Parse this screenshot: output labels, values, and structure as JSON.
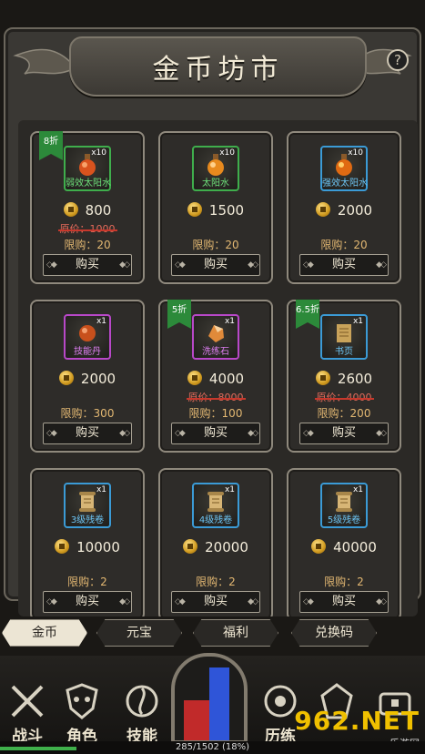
{
  "header": {
    "title": "金币坊市",
    "help_label": "?"
  },
  "items": [
    {
      "name": "弱效太阳水",
      "qty": "x10",
      "price": "800",
      "original": "原价：1000",
      "limit": "限购：20",
      "buy": "购买",
      "discount": "8折",
      "frame_color": "#3fae4c",
      "name_color": "#6de07a",
      "icon": "potion-red-icon"
    },
    {
      "name": "太阳水",
      "qty": "x10",
      "price": "1500",
      "original": "",
      "limit": "限购：20",
      "buy": "购买",
      "discount": "",
      "frame_color": "#3fae4c",
      "name_color": "#6de07a",
      "icon": "potion-orange-icon"
    },
    {
      "name": "强效太阳水",
      "qty": "x10",
      "price": "2000",
      "original": "",
      "limit": "限购：20",
      "buy": "购买",
      "discount": "",
      "frame_color": "#3b9bd6",
      "name_color": "#6cc3f2",
      "icon": "potion-gold-icon"
    },
    {
      "name": "技能丹",
      "qty": "x1",
      "price": "2000",
      "original": "",
      "limit": "限购：300",
      "buy": "购买",
      "discount": "",
      "frame_color": "#b848c8",
      "name_color": "#dc7ef0",
      "icon": "pill-icon"
    },
    {
      "name": "洗练石",
      "qty": "x1",
      "price": "4000",
      "original": "原价：8000",
      "limit": "限购：100",
      "buy": "购买",
      "discount": "5折",
      "frame_color": "#b848c8",
      "name_color": "#dc7ef0",
      "icon": "stone-icon"
    },
    {
      "name": "书页",
      "qty": "x1",
      "price": "2600",
      "original": "原价：4000",
      "limit": "限购：200",
      "buy": "购买",
      "discount": "6.5折",
      "frame_color": "#3b9bd6",
      "name_color": "#6cc3f2",
      "icon": "book-page-icon"
    },
    {
      "name": "3级残卷",
      "qty": "x1",
      "price": "10000",
      "original": "",
      "limit": "限购：2",
      "buy": "购买",
      "discount": "",
      "frame_color": "#3b9bd6",
      "name_color": "#6cc3f2",
      "icon": "scroll-icon"
    },
    {
      "name": "4级残卷",
      "qty": "x1",
      "price": "20000",
      "original": "",
      "limit": "限购：2",
      "buy": "购买",
      "discount": "",
      "frame_color": "#3b9bd6",
      "name_color": "#6cc3f2",
      "icon": "scroll-icon"
    },
    {
      "name": "5级残卷",
      "qty": "x1",
      "price": "40000",
      "original": "",
      "limit": "限购：2",
      "buy": "购买",
      "discount": "",
      "frame_color": "#3b9bd6",
      "name_color": "#6cc3f2",
      "icon": "scroll-icon"
    }
  ],
  "tabs": [
    {
      "label": "金币",
      "active": true
    },
    {
      "label": "元宝",
      "active": false
    },
    {
      "label": "福利",
      "active": false
    },
    {
      "label": "兑换码",
      "active": false
    }
  ],
  "nav": [
    {
      "label": "战斗",
      "icon": "crossed-swords-icon"
    },
    {
      "label": "角色",
      "icon": "mask-icon"
    },
    {
      "label": "技能",
      "icon": "triskelion-icon"
    },
    {
      "label": "历练",
      "icon": "swirl-icon"
    },
    {
      "label": "",
      "icon": "guild-icon"
    },
    {
      "label": "",
      "icon": "treasure-icon"
    }
  ],
  "exp": {
    "text": "285/1502 (18%)",
    "fraction": 0.18
  },
  "watermark": {
    "big": "962.NET",
    "small": "乐游网"
  }
}
